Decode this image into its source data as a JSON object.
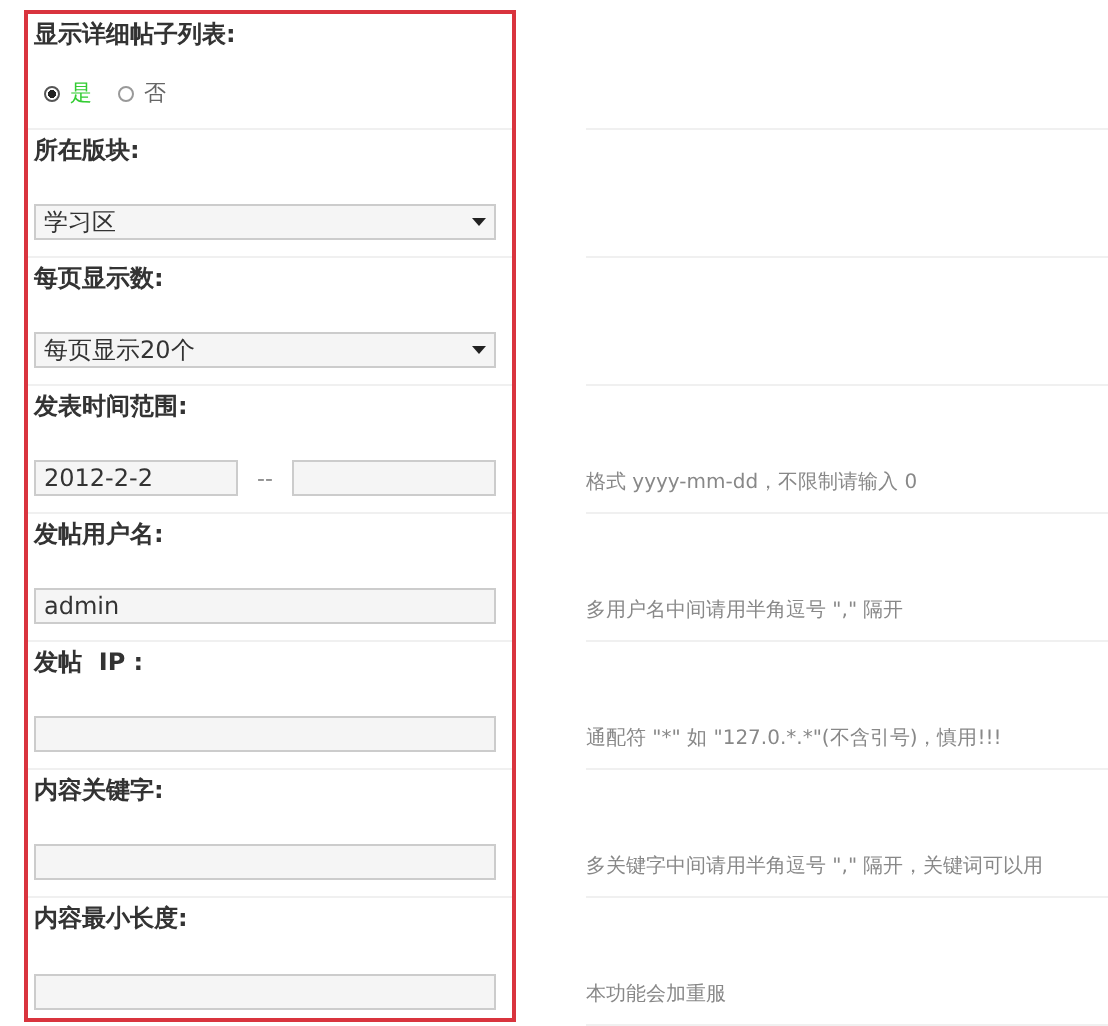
{
  "fields": [
    {
      "kind": "radio",
      "label": "显示详细帖子列表:",
      "options": [
        {
          "label": "是",
          "selected": true
        },
        {
          "label": "否",
          "selected": false
        }
      ]
    },
    {
      "kind": "select",
      "label": "所在版块:",
      "value": "学习区"
    },
    {
      "kind": "select",
      "label": "每页显示数:",
      "value": "每页显示20个"
    },
    {
      "kind": "range",
      "label": "发表时间范围:",
      "from": "2012-2-2",
      "separator": "--",
      "hint": "格式 yyyy-mm-dd，不限制请输入 0"
    },
    {
      "kind": "text",
      "label": "发帖用户名:",
      "value": "admin",
      "hint": "多用户名中间请用半角逗号 \",\" 隔开"
    },
    {
      "kind": "text",
      "label": "发帖  IP :",
      "hint": "通配符 \"*\" 如 \"127.0.*.*\"(不含引号)，慎用!!!"
    },
    {
      "kind": "text",
      "label": "内容关键字:",
      "hint": "多关键字中间请用半角逗号 \",\" 隔开，关键词可以用"
    },
    {
      "kind": "text",
      "label": "内容最小长度:",
      "hint": "本功能会加重服"
    }
  ]
}
